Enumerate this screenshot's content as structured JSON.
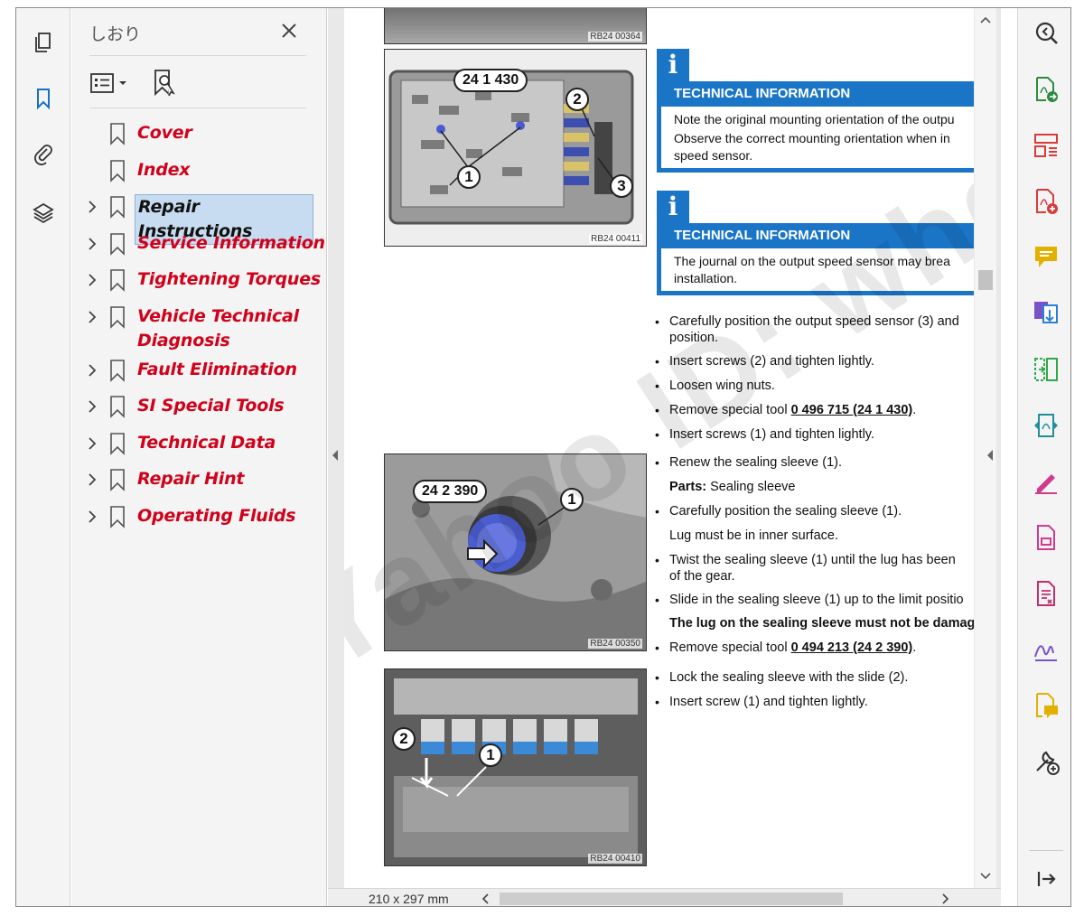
{
  "left_rail": {
    "items": [
      "pages-icon",
      "bookmark-icon",
      "attachment-icon",
      "layers-icon"
    ]
  },
  "bookmarks": {
    "title": "しおり",
    "items": [
      {
        "label": "Cover",
        "expandable": false,
        "selected": false
      },
      {
        "label": "Index",
        "expandable": false,
        "selected": false
      },
      {
        "label": "Repair Instructions",
        "expandable": true,
        "selected": true
      },
      {
        "label": "Service Information",
        "expandable": true,
        "selected": false
      },
      {
        "label": "Tightening Torques",
        "expandable": true,
        "selected": false
      },
      {
        "label": "Vehicle Technical\nDiagnosis",
        "expandable": true,
        "selected": false
      },
      {
        "label": "Fault Elimination",
        "expandable": true,
        "selected": false
      },
      {
        "label": "SI Special Tools",
        "expandable": true,
        "selected": false
      },
      {
        "label": "Technical Data",
        "expandable": true,
        "selected": false
      },
      {
        "label": "Repair Hint",
        "expandable": true,
        "selected": false
      },
      {
        "label": "Operating Fluids",
        "expandable": true,
        "selected": false
      }
    ]
  },
  "document": {
    "figures": [
      {
        "code": "RB24 00364"
      },
      {
        "code": "RB24 00411",
        "tag": "24 1 430",
        "callouts": [
          "1",
          "2",
          "3"
        ]
      },
      {
        "code": "RB24 00350",
        "tag": "24 2 390",
        "callouts": [
          "1"
        ]
      },
      {
        "code": "RB24 00410",
        "callouts": [
          "2",
          "1"
        ]
      }
    ],
    "tech_info_1": {
      "heading": "TECHNICAL INFORMATION",
      "line1": "Note the original mounting orientation of the outpu",
      "line2": "Observe the correct mounting orientation when in",
      "line3": "speed sensor."
    },
    "tech_info_2": {
      "heading": "TECHNICAL INFORMATION",
      "line1": "The journal on the output speed sensor may brea",
      "line2": "installation."
    },
    "steps_a": {
      "s1a": "Carefully position the output speed sensor (3) and",
      "s1b": "position.",
      "s2": "Insert screws (2) and tighten lightly.",
      "s3": "Loosen wing nuts.",
      "s4_pre": "Remove special tool ",
      "s4_tool": "0 496 715 (24 1 430)",
      "s4_post": ".",
      "s5": "Insert screws (1) and tighten lightly."
    },
    "steps_b": {
      "s1": "Renew the sealing sleeve (1).",
      "parts_label": "Parts:",
      "parts_value": " Sealing sleeve",
      "s2": "Carefully position the sealing sleeve (1).",
      "note1": "Lug must be in inner surface.",
      "s3a": "Twist the sealing sleeve (1) until the lug has been",
      "s3b": "of the gear.",
      "s4": "Slide in the sealing sleeve (1) up to the limit positio",
      "warn": "The lug on the sealing sleeve must not be damag",
      "s5_pre": "Remove special tool ",
      "s5_tool": "0 494 213 (24 2 390)",
      "s5_post": "."
    },
    "steps_c": {
      "s1": "Lock the sealing sleeve with the slide (2).",
      "s2": "Insert screw (1) and tighten lightly."
    },
    "page_size": "210 x 297 mm",
    "watermark": "Yahoo ID: whqwz"
  },
  "right_rail": {
    "tools": [
      "zoom-icon",
      "export-pdf-icon",
      "organize-pages-icon",
      "create-pdf-icon",
      "comment-icon",
      "combine-files-icon",
      "compress-icon",
      "share-icon",
      "fill-sign-icon",
      "edit-pdf-icon",
      "protect-icon",
      "sign-icon",
      "send-for-review-icon",
      "more-tools-icon",
      "exit-icon"
    ]
  },
  "colors": {
    "bookmark_red": "#d0021b",
    "info_blue": "#1a75c7",
    "tool_red": "#d93b3b",
    "tool_yellow": "#e2b100",
    "tool_blue": "#2d7fd3",
    "tool_green": "#2ea84a",
    "tool_purple": "#7a52c7"
  }
}
